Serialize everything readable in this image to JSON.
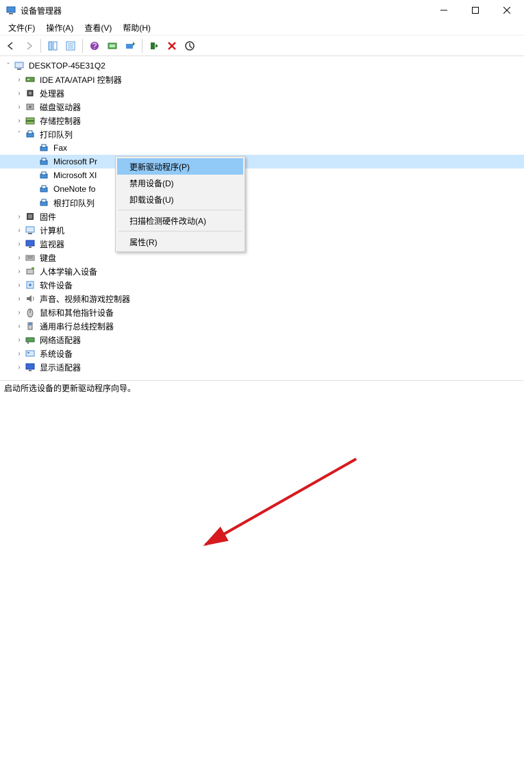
{
  "window": {
    "title": "设备管理器"
  },
  "menu": {
    "file": "文件(F)",
    "action": "操作(A)",
    "view": "查看(V)",
    "help": "帮助(H)"
  },
  "tree": {
    "root": "DESKTOP-45E31Q2",
    "items": [
      {
        "id": "ide",
        "exp": ">",
        "label": "IDE ATA/ATAPI 控制器"
      },
      {
        "id": "cpu",
        "exp": ">",
        "label": "处理器"
      },
      {
        "id": "disk",
        "exp": ">",
        "label": "磁盘驱动器"
      },
      {
        "id": "storage",
        "exp": ">",
        "label": "存储控制器"
      },
      {
        "id": "printqueue",
        "exp": "v",
        "label": "打印队列"
      },
      {
        "id": "firmware",
        "exp": ">",
        "label": "固件"
      },
      {
        "id": "computer",
        "exp": ">",
        "label": "计算机"
      },
      {
        "id": "monitor",
        "exp": ">",
        "label": "监视器"
      },
      {
        "id": "keyboard",
        "exp": ">",
        "label": "键盘"
      },
      {
        "id": "hid",
        "exp": ">",
        "label": "人体学输入设备"
      },
      {
        "id": "software",
        "exp": ">",
        "label": "软件设备"
      },
      {
        "id": "audio",
        "exp": ">",
        "label": "声音、视频和游戏控制器"
      },
      {
        "id": "mouse",
        "exp": ">",
        "label": "鼠标和其他指针设备"
      },
      {
        "id": "usb",
        "exp": ">",
        "label": "通用串行总线控制器"
      },
      {
        "id": "network",
        "exp": ">",
        "label": "网络适配器"
      },
      {
        "id": "system",
        "exp": ">",
        "label": "系统设备"
      },
      {
        "id": "display",
        "exp": ">",
        "label": "显示适配器"
      }
    ],
    "printers": [
      {
        "id": "fax",
        "label": "Fax"
      },
      {
        "id": "mspr",
        "label": "Microsoft Pr",
        "selected": true
      },
      {
        "id": "msxp",
        "label": "Microsoft XI"
      },
      {
        "id": "onenote",
        "label": "OneNote fo"
      },
      {
        "id": "rootpq",
        "label": "根打印队列"
      }
    ]
  },
  "context_menu": {
    "update": "更新驱动程序(P)",
    "disable": "禁用设备(D)",
    "uninstall": "卸载设备(U)",
    "scan": "扫描检测硬件改动(A)",
    "properties": "属性(R)"
  },
  "statusbar": "启动所选设备的更新驱动程序向导。",
  "colors": {
    "highlight": "#91c9f7",
    "selection": "#cce8ff",
    "arrow": "#d61a1e"
  }
}
